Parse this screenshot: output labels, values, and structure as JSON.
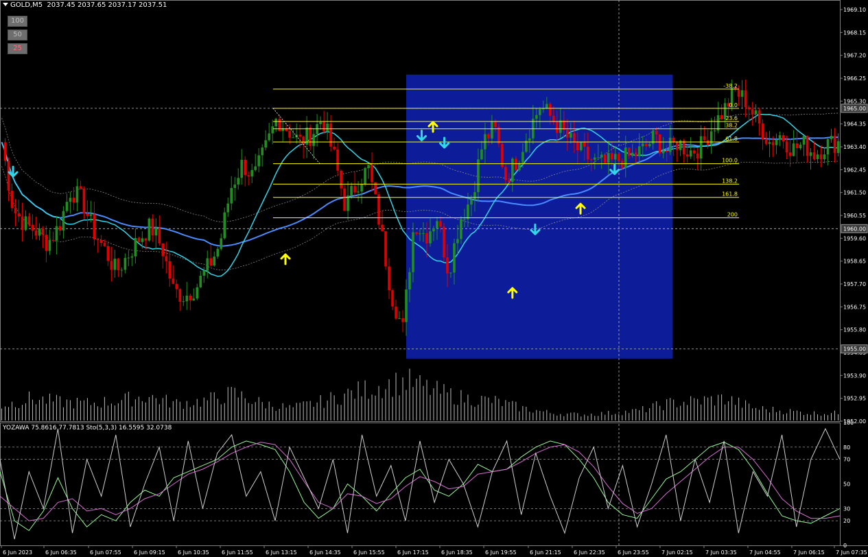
{
  "header": {
    "symbol_label": "GOLD,M5",
    "ohlc": "2037.45 2037.65 2037.17 2037.51"
  },
  "zoom_buttons": [
    {
      "label": "100",
      "text_color": "#bdbdbd"
    },
    {
      "label": "50",
      "text_color": "#bdbdbd"
    },
    {
      "label": "25",
      "text_color": "#ff7070"
    }
  ],
  "colors": {
    "background": "#000000",
    "bull": "#1f8f1f",
    "bear": "#e00000",
    "ma_fast": "#33d6e8",
    "ma_slow": "#4a8cff",
    "fibo": "#ffff00",
    "box": "#0d1d9a",
    "arrow_up": "#ffff00",
    "arrow_down": "#33d6e8",
    "stoch_main": "#98fb98",
    "stoch_signal": "#da70d6",
    "yozawa": "#d0d0d0"
  },
  "chart_data": [
    {
      "type": "candlestick",
      "symbol": "GOLD",
      "timeframe": "M5",
      "ylim": [
        1952.0,
        1969.5
      ],
      "y_ticks": [
        "1969.10",
        "1968.15",
        "1967.20",
        "1966.25",
        "1965.30",
        "1964.35",
        "1963.40",
        "1962.45",
        "1961.50",
        "1960.55",
        "1959.60",
        "1958.65",
        "1957.70",
        "1956.75",
        "1955.80",
        "1954.85",
        "1953.90",
        "1952.95",
        "1952.00"
      ],
      "price_markers": [
        "1965.00",
        "1960.00",
        "1955.00"
      ],
      "x_ticks": [
        "6 Jun 2023",
        "6 Jun 06:35",
        "6 Jun 07:55",
        "6 Jun 09:15",
        "6 Jun 10:35",
        "6 Jun 11:55",
        "6 Jun 13:15",
        "6 Jun 14:35",
        "6 Jun 15:55",
        "6 Jun 17:15",
        "6 Jun 18:35",
        "6 Jun 19:55",
        "6 Jun 21:15",
        "6 Jun 22:35",
        "6 Jun 23:55",
        "7 Jun 02:15",
        "7 Jun 03:35",
        "7 Jun 04:55",
        "7 Jun 06:15",
        "7 Jun 07:35"
      ],
      "close_path": [
        [
          0,
          1963.6
        ],
        [
          1,
          1960.8
        ],
        [
          2,
          1960.2
        ],
        [
          3,
          1959.9
        ],
        [
          4,
          1959.4
        ],
        [
          5,
          1960.1
        ],
        [
          6,
          1961.6
        ],
        [
          7,
          1961.2
        ],
        [
          8,
          1959.9
        ],
        [
          9,
          1959.1
        ],
        [
          10,
          1958.2
        ],
        [
          11,
          1958.9
        ],
        [
          12,
          1959.6
        ],
        [
          13,
          1960.1
        ],
        [
          14,
          1959.2
        ],
        [
          15,
          1957.4
        ],
        [
          16,
          1957.2
        ],
        [
          17,
          1957.6
        ],
        [
          18,
          1958.4
        ],
        [
          19,
          1959.3
        ],
        [
          20,
          1961.7
        ],
        [
          21,
          1962.7
        ],
        [
          22,
          1962.1
        ],
        [
          23,
          1963.3
        ],
        [
          24,
          1964.6
        ],
        [
          25,
          1964.1
        ],
        [
          26,
          1963.6
        ],
        [
          27,
          1963.9
        ],
        [
          28,
          1964.6
        ],
        [
          29,
          1963.0
        ],
        [
          30,
          1960.9
        ],
        [
          31,
          1961.9
        ],
        [
          32,
          1962.5
        ],
        [
          33,
          1960.2
        ],
        [
          34,
          1957.3
        ],
        [
          35,
          1955.8
        ],
        [
          36,
          1960.3
        ],
        [
          37,
          1959.7
        ],
        [
          38,
          1960.5
        ],
        [
          39,
          1958.2
        ],
        [
          40,
          1960.4
        ],
        [
          41,
          1961.3
        ],
        [
          42,
          1963.6
        ],
        [
          43,
          1964.2
        ],
        [
          44,
          1962.1
        ],
        [
          45,
          1962.9
        ],
        [
          46,
          1964.1
        ],
        [
          47,
          1965.1
        ],
        [
          48,
          1964.6
        ],
        [
          49,
          1964.0
        ],
        [
          50,
          1963.4
        ],
        [
          51,
          1963.0
        ],
        [
          52,
          1962.7
        ],
        [
          53,
          1962.7
        ],
        [
          54,
          1962.9
        ],
        [
          55,
          1963.0
        ],
        [
          56,
          1963.3
        ],
        [
          57,
          1963.8
        ],
        [
          58,
          1963.2
        ],
        [
          59,
          1963.6
        ],
        [
          60,
          1963.2
        ],
        [
          61,
          1963.4
        ],
        [
          62,
          1964.2
        ],
        [
          63,
          1964.9
        ],
        [
          64,
          1965.7
        ],
        [
          65,
          1965.3
        ],
        [
          66,
          1964.4
        ],
        [
          67,
          1963.6
        ],
        [
          68,
          1963.9
        ],
        [
          69,
          1963.3
        ],
        [
          70,
          1963.5
        ],
        [
          71,
          1963.1
        ],
        [
          72,
          1963.5
        ],
        [
          73,
          1963.6
        ]
      ],
      "volume_ylim": [
        0,
        100
      ],
      "volume_profile": [
        [
          0,
          30
        ],
        [
          5,
          45
        ],
        [
          10,
          38
        ],
        [
          15,
          35
        ],
        [
          20,
          40
        ],
        [
          25,
          50
        ],
        [
          30,
          35
        ],
        [
          35,
          40
        ],
        [
          40,
          55
        ],
        [
          45,
          35
        ],
        [
          50,
          25
        ],
        [
          55,
          38
        ],
        [
          60,
          55
        ],
        [
          65,
          70
        ],
        [
          70,
          80
        ],
        [
          75,
          60
        ],
        [
          80,
          45
        ],
        [
          85,
          40
        ],
        [
          90,
          25
        ],
        [
          95,
          15
        ],
        [
          100,
          12
        ],
        [
          105,
          15
        ],
        [
          110,
          20
        ],
        [
          115,
          35
        ],
        [
          120,
          40
        ],
        [
          125,
          45
        ],
        [
          130,
          25
        ],
        [
          135,
          20
        ],
        [
          140,
          15
        ],
        [
          145,
          15
        ]
      ],
      "fibonacci": {
        "levels": [
          {
            "label": "-38.2",
            "price": 1965.8
          },
          {
            "label": "0.0",
            "price": 1965.0
          },
          {
            "label": "23.6",
            "price": 1964.45
          },
          {
            "label": "38.2",
            "price": 1964.15
          },
          {
            "label": "61.8",
            "price": 1963.6
          },
          {
            "label": "100.0",
            "price": 1962.7
          },
          {
            "label": "138.2",
            "price": 1961.85
          },
          {
            "label": "161.8",
            "price": 1961.3
          },
          {
            "label": "200",
            "price": 1960.45
          }
        ]
      },
      "highlight_box": {
        "from_bar": 36,
        "to_bar": 59,
        "price_low": 1954.6,
        "price_high": 1966.4
      },
      "arrows": [
        {
          "bar": 1,
          "dir": "down",
          "price": 1962.4
        },
        {
          "bar": 25,
          "dir": "up",
          "price": 1958.7
        },
        {
          "bar": 37,
          "dir": "down",
          "price": 1963.9
        },
        {
          "bar": 38,
          "dir": "up",
          "price": 1964.2
        },
        {
          "bar": 39,
          "dir": "down",
          "price": 1963.6
        },
        {
          "bar": 45,
          "dir": "up",
          "price": 1957.3
        },
        {
          "bar": 47,
          "dir": "down",
          "price": 1960.0
        },
        {
          "bar": 51,
          "dir": "up",
          "price": 1960.8
        },
        {
          "bar": 54,
          "dir": "down",
          "price": 1962.5
        }
      ]
    },
    {
      "type": "line",
      "title": "YOZAWA 75.8616 77.7813  Sto(5,3,3) 16.5595 32.0738",
      "ylim": [
        0,
        100
      ],
      "y_ticks": [
        "100",
        "80",
        "70",
        "50",
        "30",
        "20",
        "0"
      ],
      "levels": [
        80,
        70,
        30,
        20
      ],
      "series": [
        {
          "name": "Sto(5,3,3) main",
          "color": "#98fb98",
          "values": [
            60,
            20,
            12,
            28,
            55,
            30,
            15,
            25,
            20,
            35,
            45,
            40,
            55,
            60,
            65,
            70,
            80,
            85,
            82,
            78,
            60,
            35,
            22,
            30,
            50,
            40,
            28,
            42,
            55,
            62,
            45,
            40,
            50,
            66,
            60,
            62,
            72,
            80,
            85,
            82,
            70,
            55,
            35,
            25,
            22,
            38,
            54,
            60,
            70,
            80,
            84,
            78,
            62,
            42,
            24,
            20,
            18,
            24,
            30
          ]
        },
        {
          "name": "Sto(5,3,3) signal",
          "color": "#da70d6",
          "values": [
            40,
            30,
            20,
            22,
            35,
            38,
            28,
            30,
            25,
            30,
            38,
            42,
            50,
            58,
            62,
            68,
            75,
            80,
            84,
            82,
            70,
            52,
            35,
            30,
            42,
            40,
            34,
            38,
            48,
            56,
            52,
            46,
            48,
            58,
            60,
            62,
            68,
            75,
            80,
            82,
            76,
            64,
            48,
            34,
            26,
            30,
            42,
            52,
            62,
            72,
            80,
            80,
            70,
            55,
            38,
            28,
            22,
            22,
            24
          ]
        },
        {
          "name": "YOZAWA",
          "color": "#d0d0d0",
          "values": [
            70,
            5,
            60,
            30,
            95,
            10,
            70,
            40,
            90,
            15,
            50,
            80,
            20,
            85,
            30,
            75,
            90,
            40,
            60,
            20,
            80,
            55,
            30,
            70,
            10,
            90,
            40,
            65,
            20,
            85,
            35,
            70,
            50,
            15,
            60,
            85,
            25,
            75,
            40,
            10,
            55,
            80,
            30,
            65,
            15,
            50,
            90,
            20,
            70,
            35,
            85,
            10,
            60,
            40,
            90,
            15,
            70,
            95,
            70
          ]
        }
      ]
    }
  ]
}
